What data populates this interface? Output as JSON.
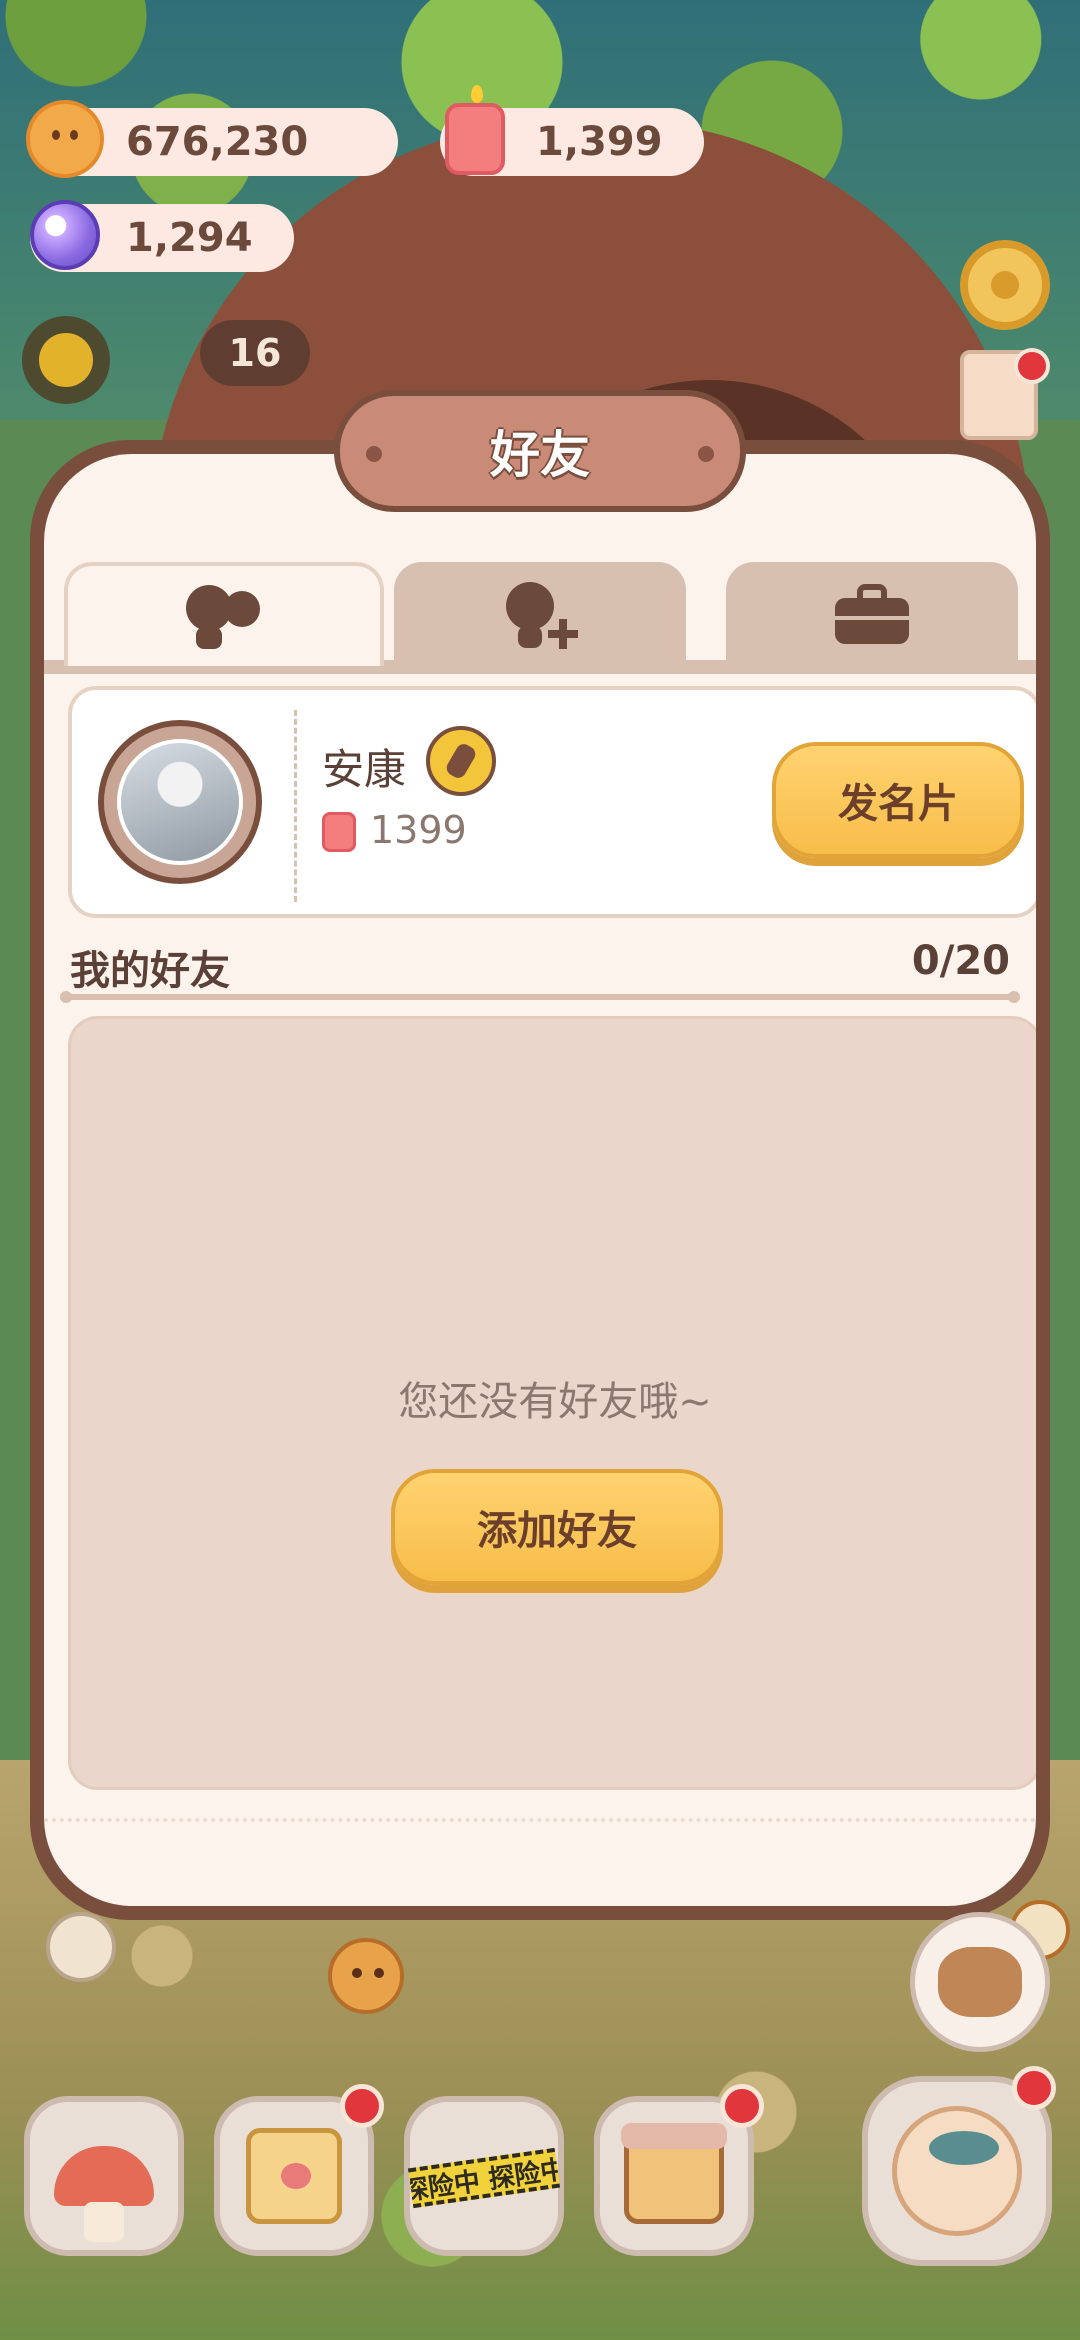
{
  "currencies": {
    "cookies": "676,230",
    "candles": "1,399",
    "crystals": "1,294"
  },
  "hud": {
    "level": "16"
  },
  "modal": {
    "title": "好友",
    "tabs": [
      {
        "icon": "friends-icon",
        "active": true
      },
      {
        "icon": "add-friend-icon",
        "active": false
      },
      {
        "icon": "briefcase-icon",
        "active": false
      }
    ],
    "profile": {
      "name": "安康",
      "score": "1399",
      "card_button": "发名片"
    },
    "friends_list": {
      "title": "我的好友",
      "count": "0/20",
      "empty_message": "您还没有好友哦~",
      "add_button": "添加好友"
    }
  },
  "bottom_nav": {
    "expedition_tape": "探险中 探险中"
  },
  "colors": {
    "modal_frame": "#7a4e3d",
    "modal_bg": "#fbf3ec",
    "button_yellow": "#f7bd4a",
    "badge_red": "#e0363c",
    "list_bg": "#ead6cb"
  }
}
